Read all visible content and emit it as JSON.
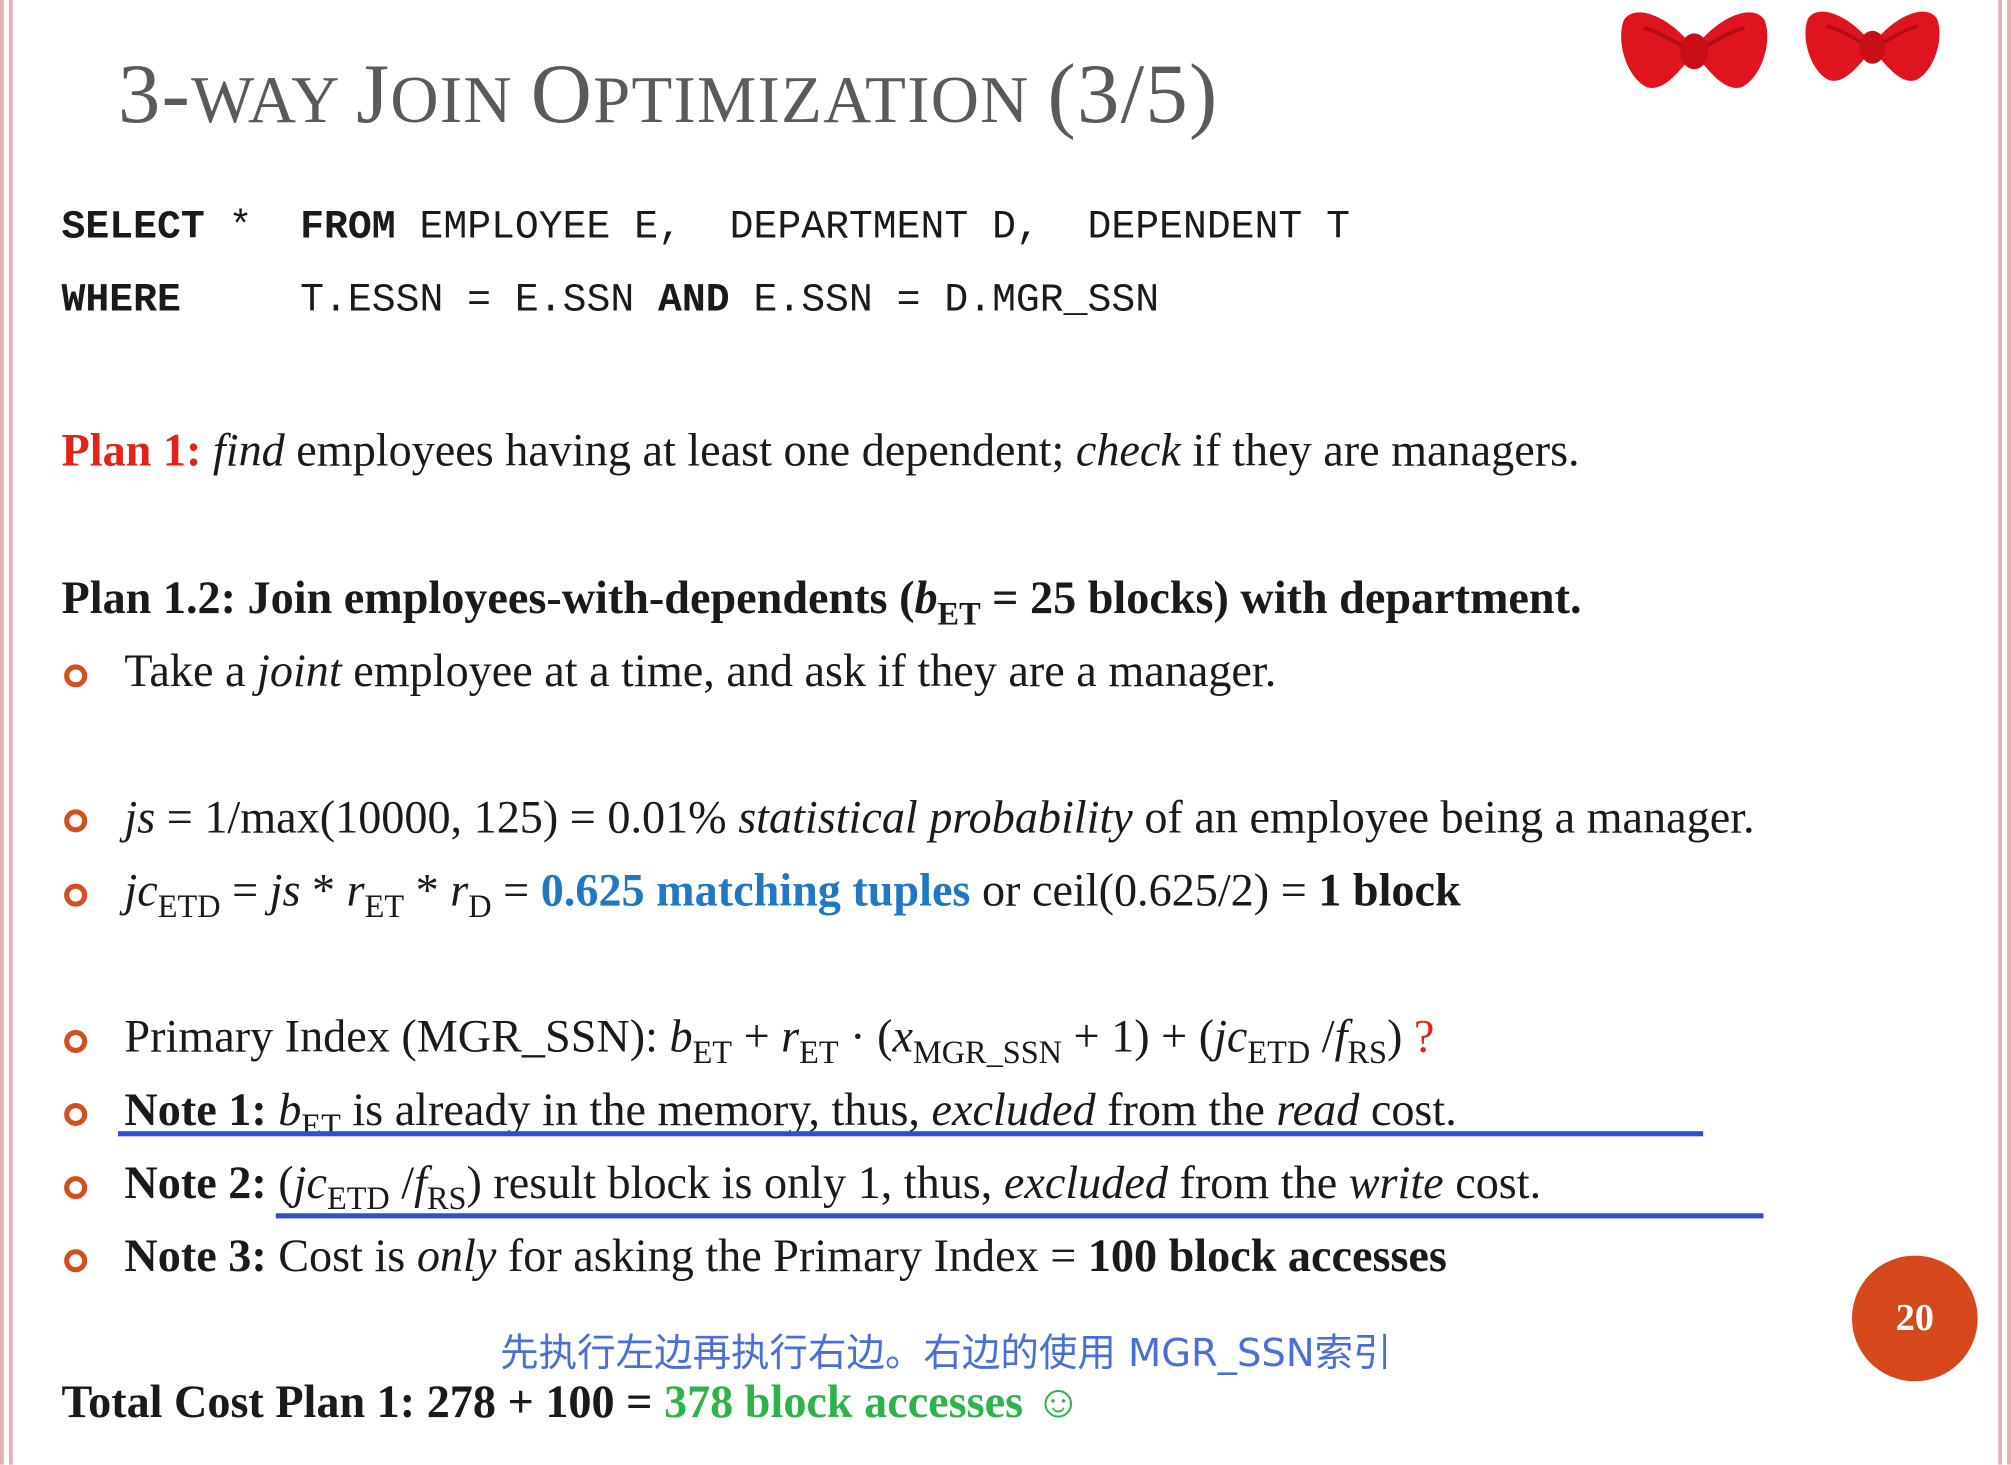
{
  "title": {
    "big1": "3-",
    "small1": "WAY ",
    "big2": "J",
    "small2": "OIN ",
    "big3": "O",
    "small3": "PTIMIZATION ",
    "big4": "(3/5)"
  },
  "sql": {
    "select_kw": "SELECT",
    "select_rest": " *  ",
    "from_kw": "FROM",
    "from_rest": " EMPLOYEE E,  DEPARTMENT D,  DEPENDENT T",
    "where_kw": "WHERE",
    "where_cond1": "     T.ESSN = E.SSN ",
    "and_kw": "AND",
    "where_cond2": " E.SSN = D.MGR_SSN"
  },
  "plan1": {
    "label": "Plan 1:",
    "find": "find",
    "mid": " employees having at least one dependent; ",
    "check": "check",
    "end": " if they are managers."
  },
  "plan12": {
    "prefix": "Plan 1.2: Join employees-with-dependents (",
    "b": "b",
    "sub": "ET",
    "suffix": " = 25 blocks) with department."
  },
  "bullets": {
    "take": {
      "pre": "Take a ",
      "joint": "joint",
      "post": " employee at a time, and ask if they are a manager."
    },
    "js": {
      "js": "js",
      "eq": " = 1/max(10000, 125) = 0.01% ",
      "stat": "statistical probability",
      "post": " of an employee being a manager."
    },
    "jc": {
      "jc": "jc",
      "jc_sub": "ETD",
      "eq1": " = ",
      "js": "js",
      "star1": " * ",
      "r1": "r",
      "r1_sub": "ET",
      "star2": " * ",
      "r2": "r",
      "r2_sub": "D",
      "eq2": " = ",
      "match": "0.625 matching tuples",
      "or": " or ceil(0.625/2) = ",
      "block": "1 block"
    },
    "primary": {
      "pre": "Primary Index (MGR_SSN): ",
      "b": "b",
      "b_sub": "ET",
      "plus1": " + ",
      "r": "r",
      "r_sub": "ET",
      "dot": " · (",
      "x": "x",
      "x_sub": "MGR_SSN",
      "plus2": " + 1) + (",
      "jc": "jc",
      "jc_sub": "ETD",
      "slash": " /",
      "f": "f",
      "f_sub": "RS",
      "close": ") ",
      "q": "?"
    },
    "note1": {
      "label": "Note 1:",
      "sp": " ",
      "b": "b",
      "b_sub": "ET",
      "mid": " is already in the memory, thus, ",
      "excluded": "excluded",
      "mid2": " from the ",
      "read": "read",
      "end": " cost."
    },
    "note2": {
      "label": "Note 2:",
      "open": " (",
      "jc": "jc",
      "jc_sub": "ETD",
      "slash": " /",
      "f": "f",
      "f_sub": "RS",
      "mid": ") result block is only 1, thus, ",
      "excluded": "excluded",
      "mid2": " from the ",
      "write": "write",
      "end": " cost."
    },
    "note3": {
      "label": "Note 3:",
      "pre": " Cost is ",
      "only": "only",
      "mid": " for asking the Primary Index = ",
      "bold": "100 block accesses"
    }
  },
  "annotation_cn": "先执行左边再执行右边。右边的使用 MGR_SSN索引",
  "total": {
    "prefix": "Total Cost Plan 1: 278 + 100 = ",
    "result": "378 block accesses ☺"
  },
  "page_number": "20",
  "colors": {
    "accent_red": "#e2231a",
    "accent_blue": "#1f78c3",
    "accent_green": "#2db34a",
    "bullet_orange": "#d54e1f",
    "underline_blue": "#2f4fd0",
    "page_circle": "#d5481c"
  }
}
